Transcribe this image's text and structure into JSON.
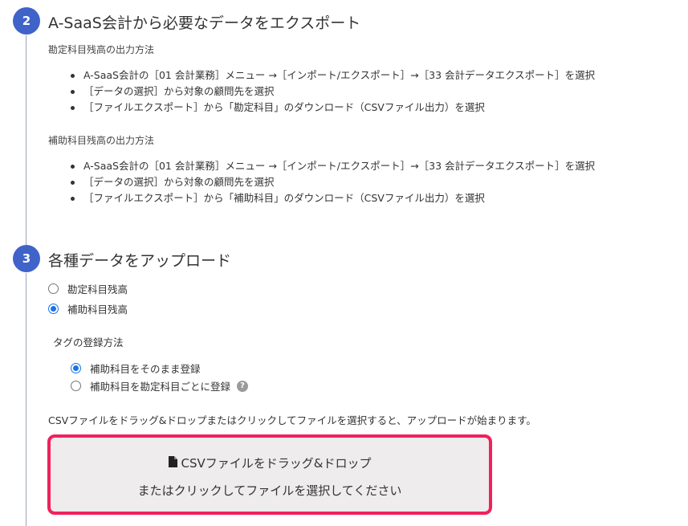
{
  "step2": {
    "number": "2",
    "title": "A-SaaS会計から必要なデータをエクスポート",
    "sections": [
      {
        "heading": "勘定科目残高の出力方法",
        "bullets": [
          "A-SaaS会計の［01 会計業務］メニュー →［インポート/エクスポート］→［33 会計データエクスポート］を選択",
          "［データの選択］から対象の顧問先を選択",
          "［ファイルエクスポート］から「勘定科目」のダウンロード（CSVファイル出力）を選択"
        ]
      },
      {
        "heading": "補助科目残高の出力方法",
        "bullets": [
          "A-SaaS会計の［01 会計業務］メニュー →［インポート/エクスポート］→［33 会計データエクスポート］を選択",
          "［データの選択］から対象の顧問先を選択",
          "［ファイルエクスポート］から「補助科目」のダウンロード（CSVファイル出力）を選択"
        ]
      }
    ]
  },
  "step3": {
    "number": "3",
    "title": "各種データをアップロード",
    "data_type_options": [
      {
        "label": "勘定科目残高",
        "checked": false
      },
      {
        "label": "補助科目残高",
        "checked": true
      }
    ],
    "tag_heading": "タグの登録方法",
    "tag_options": [
      {
        "label": "補助科目をそのまま登録",
        "checked": true
      },
      {
        "label": "補助科目を勘定科目ごとに登録",
        "checked": false,
        "help_icon": "question-circle-icon"
      }
    ],
    "note": "CSVファイルをドラッグ&ドロップまたはクリックしてファイルを選択すると、アップロードが始まります。",
    "dropzone": {
      "icon": "file-icon",
      "line1": "CSVファイルをドラッグ&ドロップ",
      "line2": "またはクリックしてファイルを選択してください",
      "border_color": "#f0215c",
      "background": "#eeecec"
    }
  },
  "colors": {
    "step_circle": "#3f63c8",
    "timeline": "#9aa3b5",
    "radio_checked": "#1a73e8"
  }
}
